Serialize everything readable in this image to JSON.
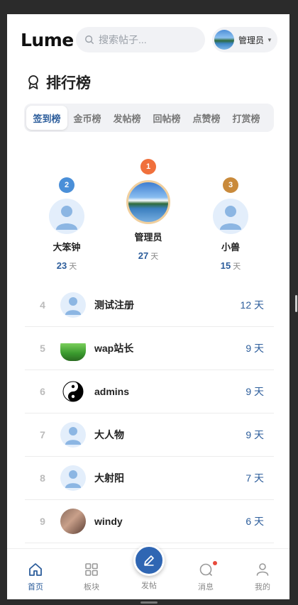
{
  "app": {
    "logo": "Lume"
  },
  "search": {
    "placeholder": "搜索帖子..."
  },
  "user": {
    "name": "管理员"
  },
  "page": {
    "title": "排行榜"
  },
  "tabs": [
    {
      "label": "签到榜",
      "active": true
    },
    {
      "label": "金币榜"
    },
    {
      "label": "发帖榜"
    },
    {
      "label": "回帖榜"
    },
    {
      "label": "点赞榜"
    },
    {
      "label": "打赏榜"
    }
  ],
  "podium": {
    "first": {
      "rank": "1",
      "name": "管理员",
      "value": "27",
      "unit": "天"
    },
    "second": {
      "rank": "2",
      "name": "大笨钟",
      "value": "23",
      "unit": "天"
    },
    "third": {
      "rank": "3",
      "name": "小兽",
      "value": "15",
      "unit": "天"
    }
  },
  "list": [
    {
      "rank": "4",
      "name": "测试注册",
      "days": "12 天",
      "avatar": "default-avatar"
    },
    {
      "rank": "5",
      "name": "wap站长",
      "days": "9 天",
      "avatar": "tree-avatar"
    },
    {
      "rank": "6",
      "name": "admins",
      "days": "9 天",
      "avatar": "yinyang-avatar"
    },
    {
      "rank": "7",
      "name": "大人物",
      "days": "9 天",
      "avatar": "default-avatar"
    },
    {
      "rank": "8",
      "name": "大射阳",
      "days": "7 天",
      "avatar": "default-avatar"
    },
    {
      "rank": "9",
      "name": "windy",
      "days": "6 天",
      "avatar": "photo-avatar"
    }
  ],
  "nav": {
    "home": "首页",
    "boards": "板块",
    "post": "发帖",
    "messages": "消息",
    "mine": "我的"
  },
  "colors": {
    "accent": "#2c5d9b",
    "rank1": "#f0703c",
    "rank2": "#4a8fd8",
    "rank3": "#c98a3b",
    "fab": "#2f66b3",
    "notify_dot": "#e84a3c"
  }
}
